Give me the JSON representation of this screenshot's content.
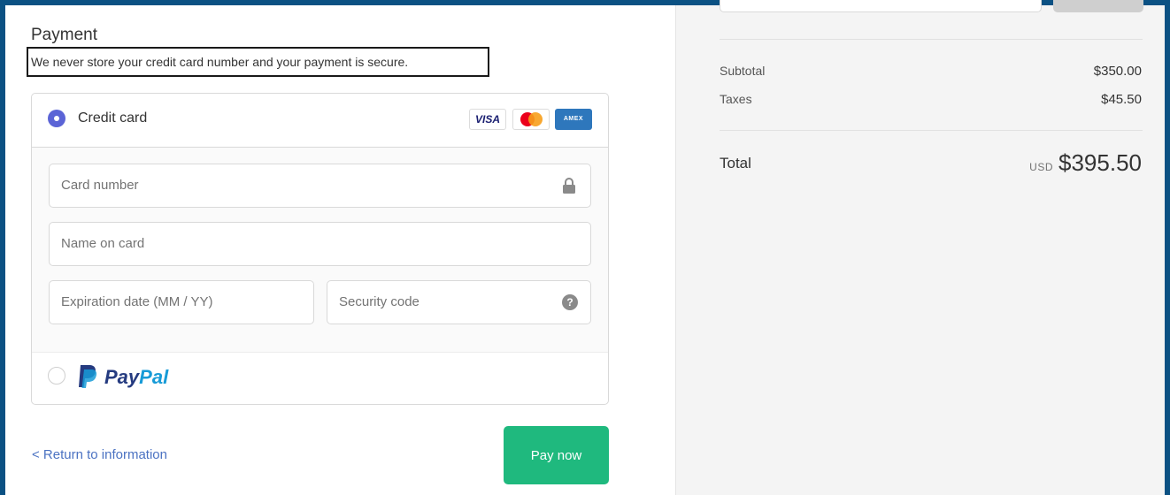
{
  "payment": {
    "title": "Payment",
    "secure_note": "We never store your credit card number and your payment is secure."
  },
  "methods": {
    "credit_card": {
      "label": "Credit card",
      "selected": true,
      "logos": {
        "visa": "VISA",
        "amex": "AMEX"
      }
    },
    "fields": {
      "card_number": "Card number",
      "name_on_card": "Name on card",
      "expiration": "Expiration date (MM / YY)",
      "security_code": "Security code",
      "help_glyph": "?"
    },
    "paypal": {
      "selected": false,
      "logo_pay": "Pay",
      "logo_pal": "Pal"
    }
  },
  "footer": {
    "return_link": "< Return to information",
    "pay_button": "Pay now"
  },
  "summary": {
    "subtotal_label": "Subtotal",
    "subtotal_value": "$350.00",
    "taxes_label": "Taxes",
    "taxes_value": "$45.50",
    "total_label": "Total",
    "currency": "USD",
    "total_value": "$395.50"
  },
  "colors": {
    "frame": "#0b5183",
    "radio_selected": "#5b64d6",
    "pay_button": "#1fb97e",
    "link": "#4b72c2"
  },
  "icons": [
    "lock-icon",
    "help-icon",
    "visa-logo",
    "mastercard-logo",
    "amex-logo",
    "paypal-logo"
  ]
}
